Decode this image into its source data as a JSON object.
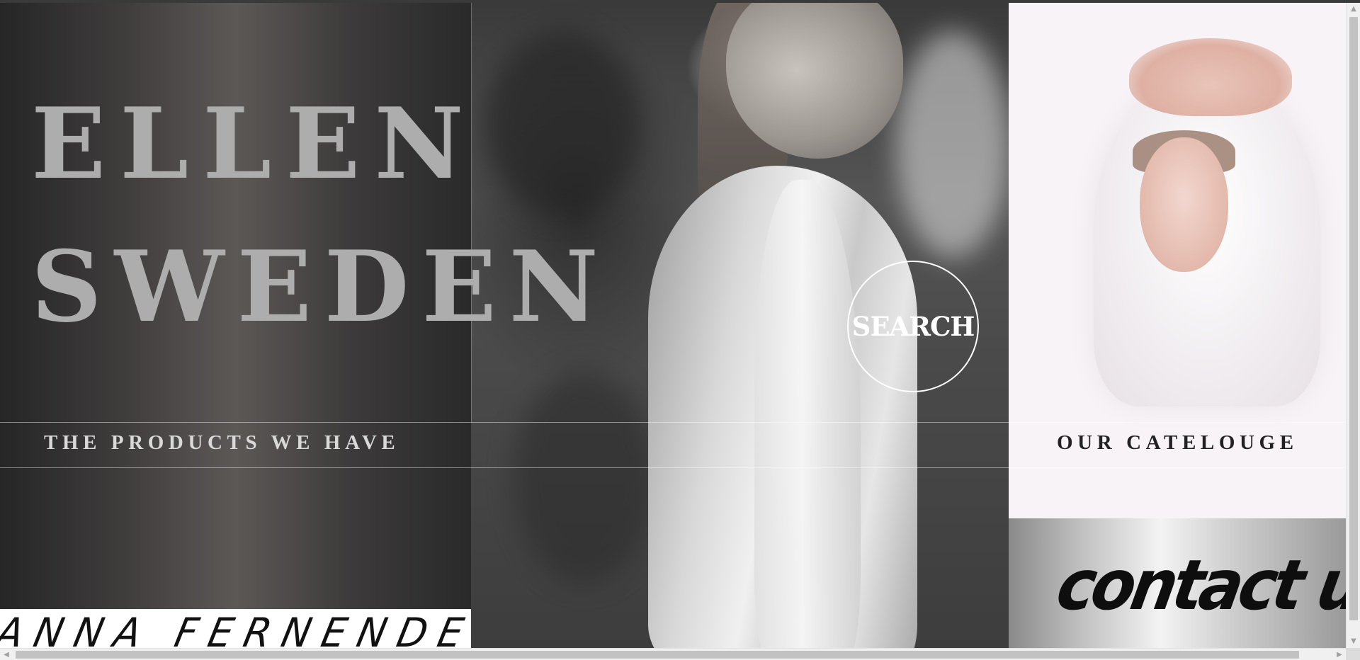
{
  "brand": {
    "line1": "ELLEN",
    "line2": "SWEDEN"
  },
  "hero": {
    "search_label": "SEARCH"
  },
  "nav": {
    "products_label": "THE PRODUCTS WE HAVE",
    "catalogue_label": "OUR CATELOUGE"
  },
  "signature": {
    "text": "ANNA FERNENDES."
  },
  "contact": {
    "label": "contact us."
  },
  "scrollbars": {
    "up_icon": "▲",
    "down_icon": "▼",
    "left_icon": "◀",
    "right_icon": "▶"
  },
  "colors": {
    "brand_text": "#adadad",
    "band_text_light": "#d9d9d9",
    "band_text_dark": "#222222",
    "search_outline": "#ffffff"
  }
}
